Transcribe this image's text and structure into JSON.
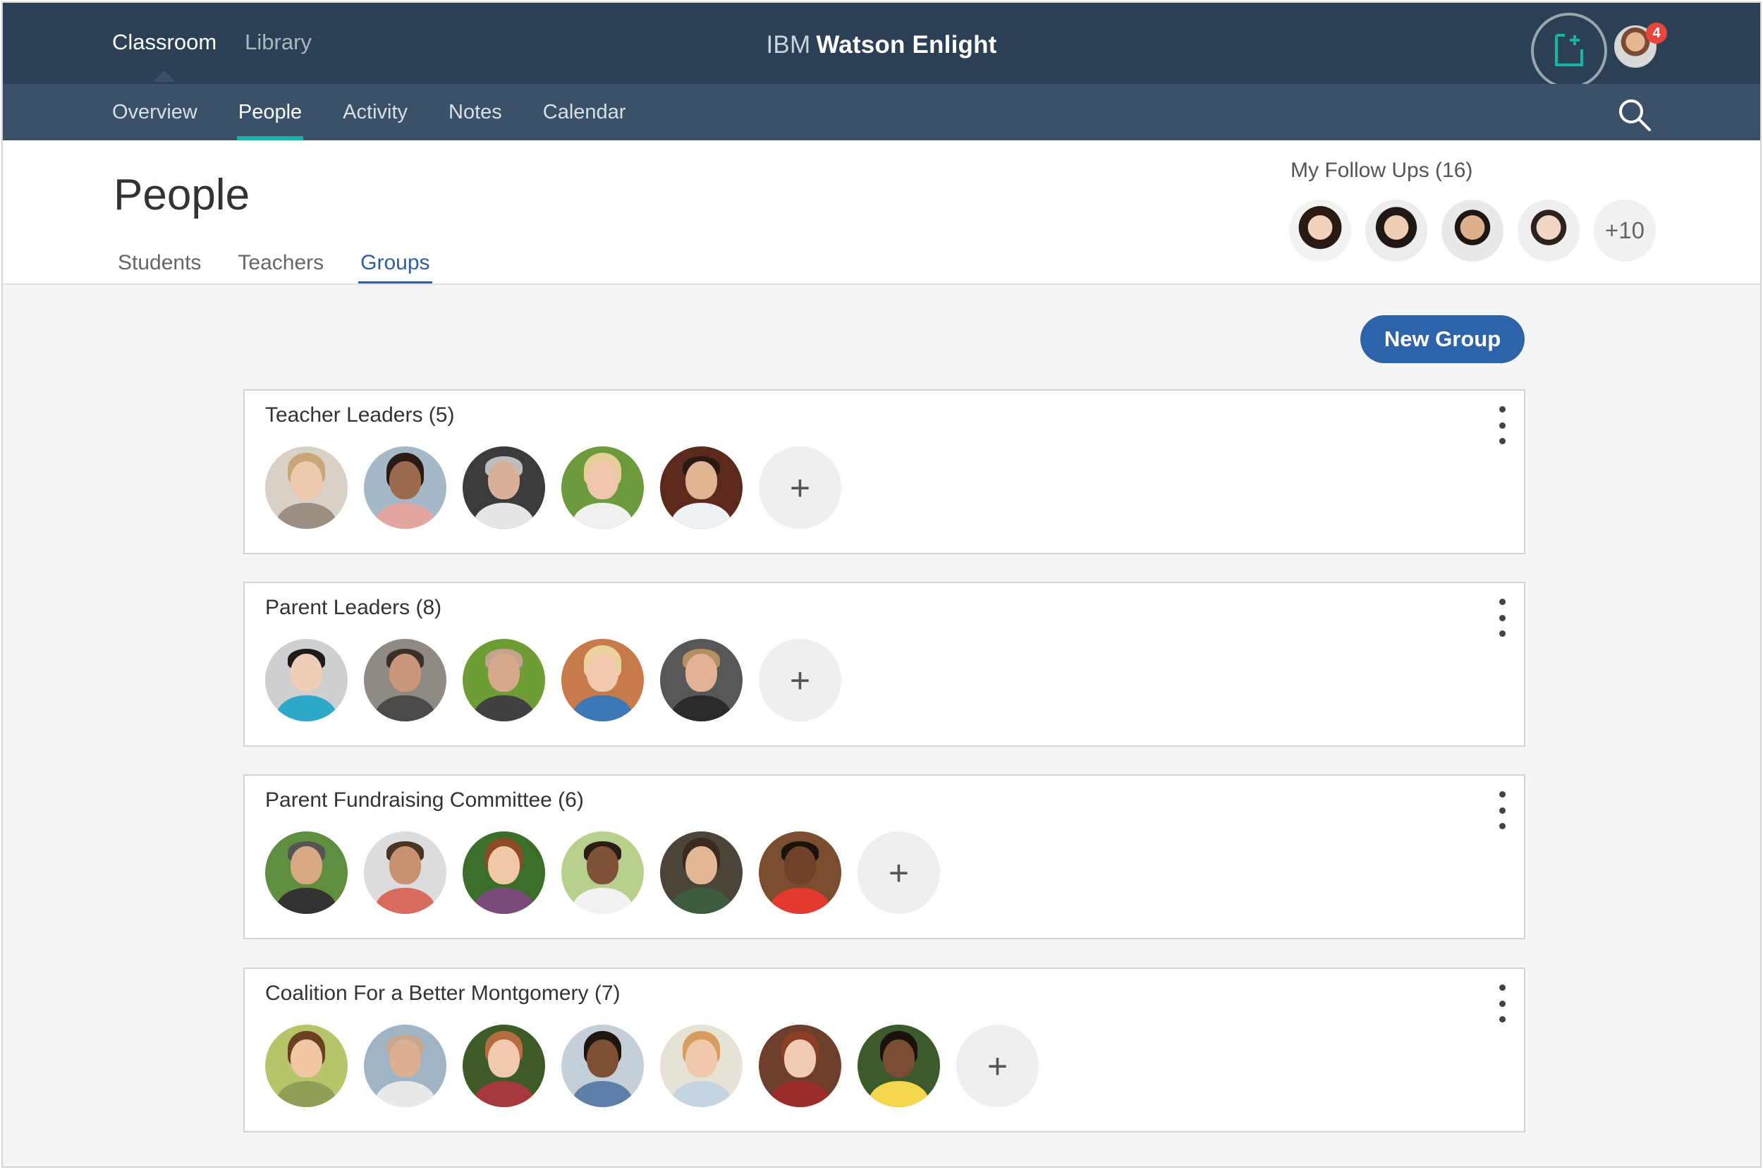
{
  "app": {
    "brand_prefix": "IBM",
    "brand_name": "Watson Enlight",
    "top_nav": [
      {
        "label": "Classroom"
      },
      {
        "label": "Library"
      }
    ],
    "notification_count": "4"
  },
  "sub_nav": [
    {
      "label": "Overview"
    },
    {
      "label": "People"
    },
    {
      "label": "Activity"
    },
    {
      "label": "Notes"
    },
    {
      "label": "Calendar"
    }
  ],
  "page": {
    "title": "People",
    "tabs": [
      {
        "label": "Students"
      },
      {
        "label": "Teachers"
      },
      {
        "label": "Groups"
      }
    ]
  },
  "followups": {
    "label": "My Follow Ups (16)",
    "more_label": "+10"
  },
  "new_group_label": "New Group",
  "groups": [
    {
      "title": "Teacher Leaders (5)"
    },
    {
      "title": "Parent Leaders (8)"
    },
    {
      "title": "Parent Fundraising Committee (6)"
    },
    {
      "title": "Coalition For a Better Montgomery (7)"
    }
  ],
  "colors": {
    "top_bar": "#2b4055",
    "sub_bar": "#3a5168",
    "accent_teal": "#17b3a3",
    "link_blue": "#2e5fa3",
    "button_blue": "#2d63a8"
  },
  "icons": {
    "add_content": "add-content-icon",
    "search": "search-icon",
    "overflow": "kebab-menu-icon",
    "add_member": "plus-icon"
  }
}
